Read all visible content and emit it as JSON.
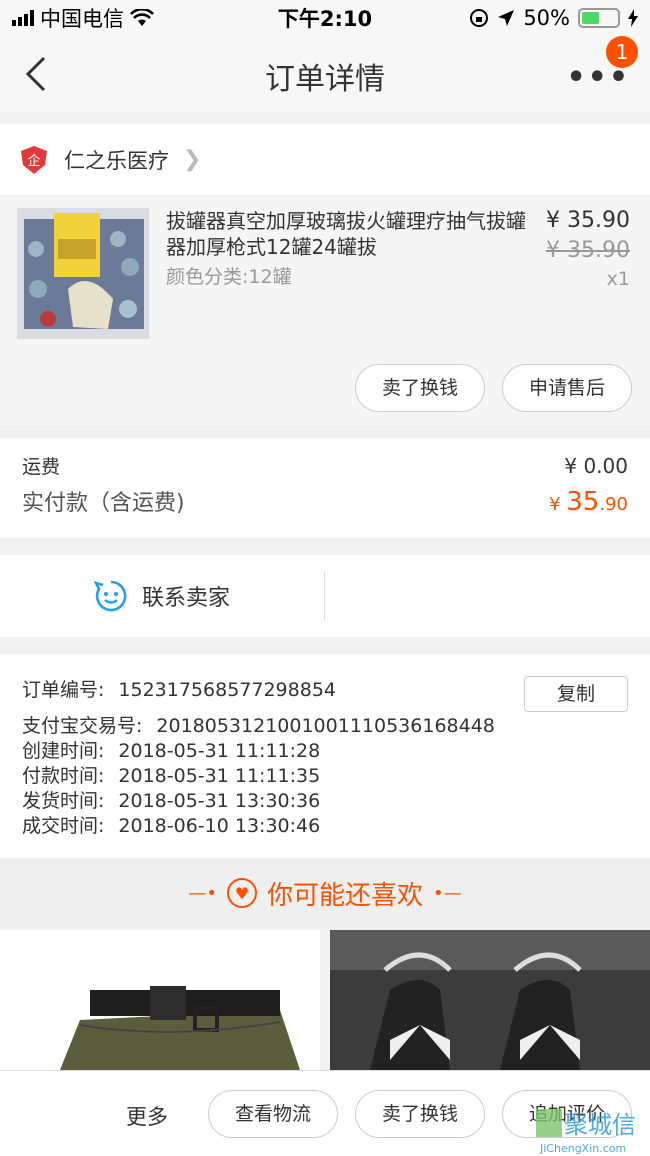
{
  "status_bar": {
    "carrier": "中国电信",
    "time": "下午2:10",
    "battery": "50%"
  },
  "nav": {
    "title": "订单详情",
    "more_badge": "1"
  },
  "shop": {
    "name": "仁之乐医疗",
    "logo_text": "企"
  },
  "product": {
    "title": "拔罐器真空加厚玻璃拔火罐理疗抽气拔罐器加厚枪式12罐24罐拔",
    "spec": "颜色分类:12罐",
    "price": "¥ 35.90",
    "original_price": "¥ 35.90",
    "quantity": "x1",
    "actions": [
      "卖了换钱",
      "申请售后"
    ]
  },
  "fees": {
    "shipping_label": "运费",
    "shipping_value": "¥ 0.00",
    "paid_label": "实付款（含运费)",
    "paid_currency": "¥ ",
    "paid_int": "35",
    "paid_dec": ".90"
  },
  "contact": {
    "label": "联系卖家"
  },
  "order_info": {
    "copy_label": "复制",
    "rows": [
      {
        "key": "订单编号:",
        "value": "152317568577298854"
      },
      {
        "key": "支付宝交易号:",
        "value": "2018053121001001110536168448"
      },
      {
        "key": "创建时间:",
        "value": "2018-05-31 11:11:28"
      },
      {
        "key": "付款时间:",
        "value": "2018-05-31 11:11:35"
      },
      {
        "key": "发货时间:",
        "value": "2018-05-31 13:30:36"
      },
      {
        "key": "成交时间:",
        "value": "2018-06-10 13:30:46"
      }
    ]
  },
  "recommend": {
    "title": "你可能还喜欢"
  },
  "bottom_bar": {
    "more": "更多",
    "buttons": [
      "查看物流",
      "卖了换钱",
      "追加评价"
    ]
  },
  "watermark": {
    "line1": "聚城信",
    "line2": "JiChengXin.com"
  },
  "colors": {
    "accent": "#ff5000",
    "contact_icon": "#1ea1f2"
  }
}
